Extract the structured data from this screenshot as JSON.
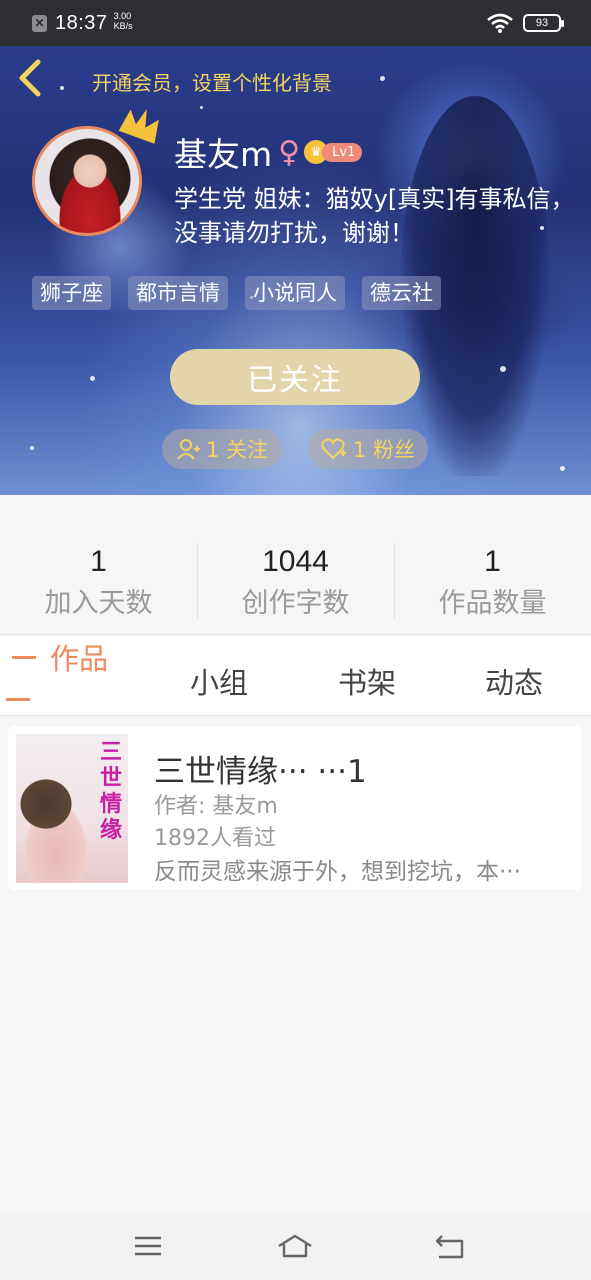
{
  "status_bar": {
    "time": "18:37",
    "net_speed_value": "3.00",
    "net_speed_unit": "KB/s",
    "battery": "93"
  },
  "header": {
    "vip_banner": "开通会员，设置个性化背景",
    "name": "基友m",
    "gender_symbol": "♀",
    "level": "Lv1",
    "bio": "学生党 姐妹：猫奴y[真实]有事私信，没事请勿打扰，谢谢！",
    "tags": [
      "狮子座",
      "都市言情",
      "小说同人",
      "德云社"
    ],
    "follow_button": "已关注",
    "following_label": "1 关注",
    "fans_label": "1 粉丝"
  },
  "stats": [
    {
      "value": "1",
      "label": "加入天数"
    },
    {
      "value": "1044",
      "label": "创作字数"
    },
    {
      "value": "1",
      "label": "作品数量"
    }
  ],
  "tabs": [
    "作品",
    "小组",
    "书架",
    "动态"
  ],
  "active_tab": "作品",
  "works": [
    {
      "cover_text": "三世情缘",
      "title": "三世情缘··· ···1",
      "author": "作者: 基友m",
      "views": "1892人看过",
      "desc": "反而灵感来源于外，想到挖坑，本···"
    }
  ],
  "colors": {
    "accent": "#ee8a5c",
    "gold": "#f4d35e",
    "follow_bg": "#e4d4a9"
  }
}
